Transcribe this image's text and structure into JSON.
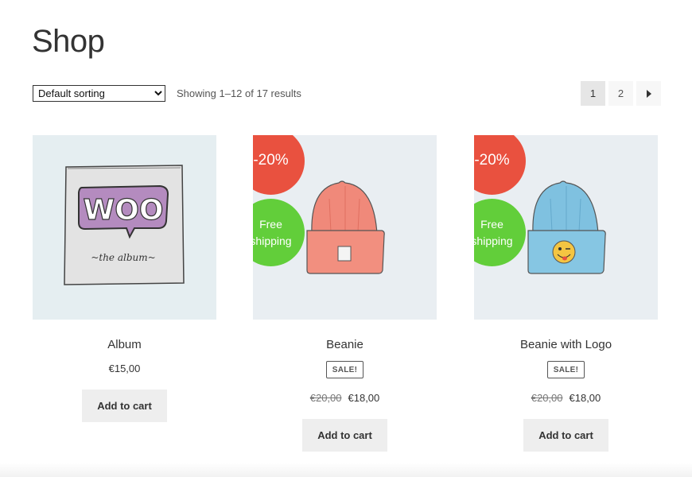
{
  "page": {
    "title": "Shop"
  },
  "toolbar": {
    "sorting_selected": "Default sorting",
    "result_count": "Showing 1–12 of 17 results"
  },
  "pagination": {
    "pages": [
      "1",
      "2"
    ],
    "current": "1",
    "next_icon": "caret-right-icon"
  },
  "products": [
    {
      "title": "Album",
      "price": "€15,00",
      "add_to_cart": "Add to cart",
      "image": "album-woo-icon",
      "image_text": "WOO",
      "image_caption": "~the album~"
    },
    {
      "title": "Beanie",
      "badge_discount": "-20%",
      "badge_shipping": "Free shipping",
      "sale_flag": "SALE!",
      "price_old": "€20,00",
      "price": "€18,00",
      "add_to_cart": "Add to cart",
      "image": "orange-beanie-icon"
    },
    {
      "title": "Beanie with Logo",
      "badge_discount": "-20%",
      "badge_shipping": "Free shipping",
      "sale_flag": "SALE!",
      "price_old": "€20,00",
      "price": "€18,00",
      "add_to_cart": "Add to cart",
      "image": "blue-beanie-with-logo-icon"
    }
  ],
  "colors": {
    "discount_badge": "#e9513f",
    "shipping_badge": "#62ce3a",
    "button_bg": "#eeeeee",
    "thumb_bg": "#e9eef2"
  }
}
